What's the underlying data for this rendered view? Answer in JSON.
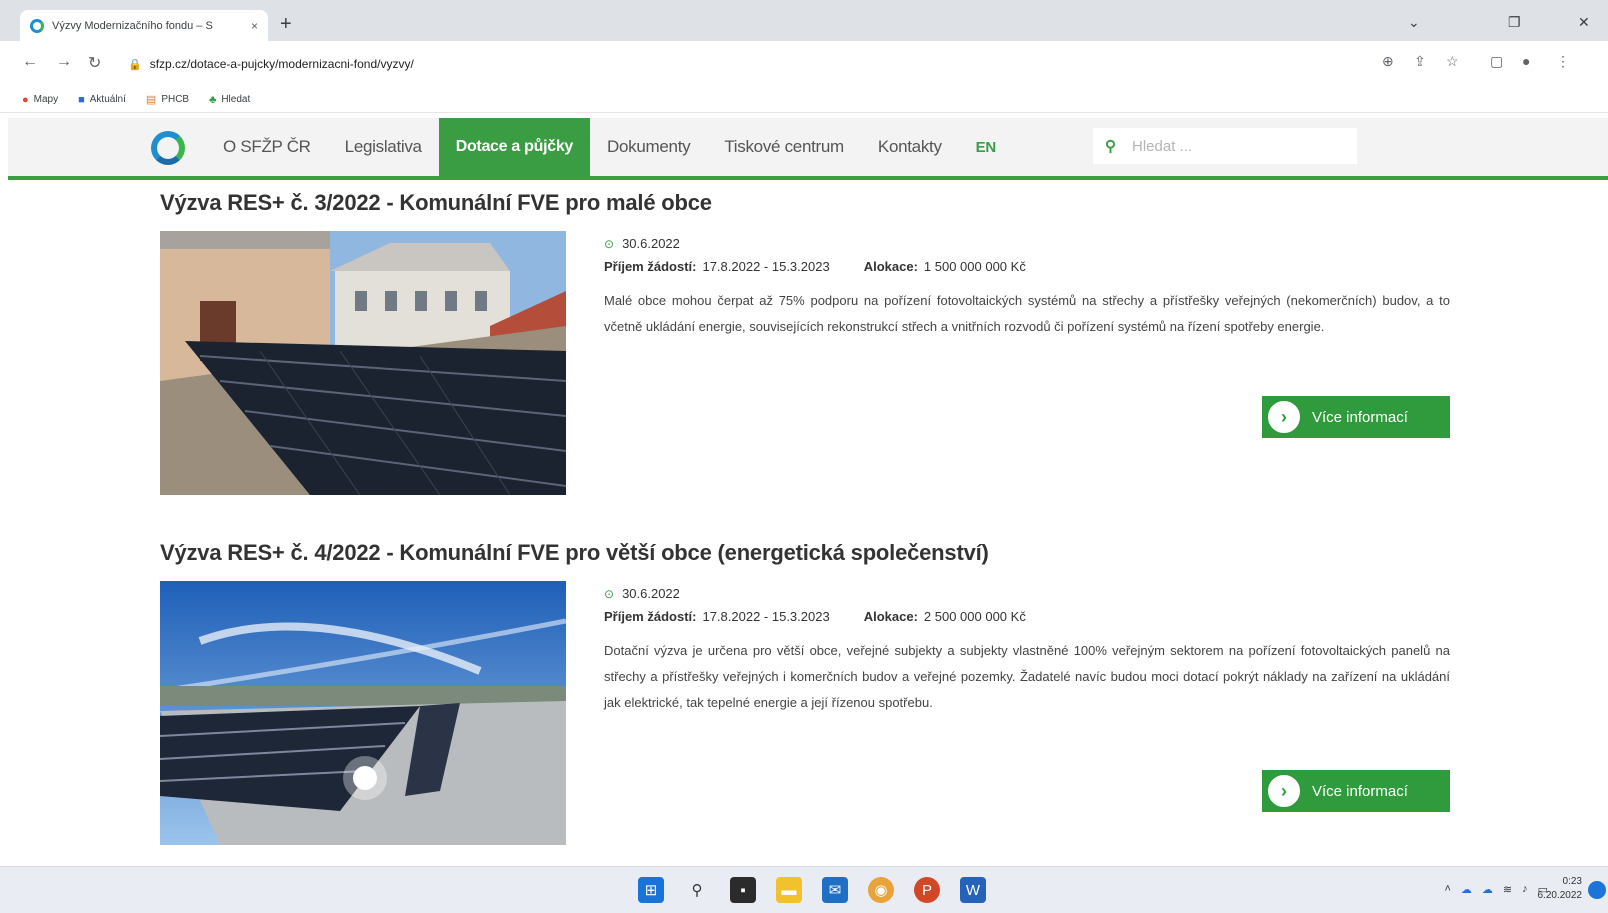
{
  "browser": {
    "tab_title": "Výzvy Modernizačního fondu – S",
    "tab_close": "×",
    "new_tab": "+",
    "url": "sfzp.cz/dotace-a-pujcky/modernizacni-fond/vyzvy/",
    "bookmarks": [
      {
        "label": "Mapy",
        "icon": "map-pin-icon"
      },
      {
        "label": "Aktuální",
        "icon": "news-icon"
      },
      {
        "label": "PHCB",
        "icon": "chart-icon"
      },
      {
        "label": "Hledat",
        "icon": "plant-icon"
      }
    ]
  },
  "site": {
    "menu": [
      "O SFŽP ČR",
      "Legislativa",
      "Dotace a půjčky",
      "Dokumenty",
      "Tiskové centrum",
      "Kontakty"
    ],
    "lang": "EN",
    "search_placeholder": "Hledat ...",
    "brand_color": "#3a9c43"
  },
  "articles": [
    {
      "title": "Výzva RES+ č. 3/2022 - Komunální FVE pro malé obce",
      "date": "30.6.2022",
      "prijem_label": "Příjem žádostí:",
      "prijem_value": "17.8.2022 - 15.3.2023",
      "alokace_label": "Alokace:",
      "alokace_value": "1 500 000 000 Kč",
      "description": "Malé obce mohou čerpat až 75% podporu na pořízení fotovoltaických systémů na střechy a přístřešky veřejných (nekomerčních) budov, a to včetně ukládání energie, souvisejících rekonstrukcí střech a vnitřních rozvodů či pořízení systémů na řízení spotřeby energie.",
      "more": "Více informací"
    },
    {
      "title": "Výzva RES+ č. 4/2022 - Komunální FVE pro větší obce (energetická společenství)",
      "date": "30.6.2022",
      "prijem_label": "Příjem žádostí:",
      "prijem_value": "17.8.2022 - 15.3.2023",
      "alokace_label": "Alokace:",
      "alokace_value": "2 500 000 000 Kč",
      "description": "Dotační výzva je určena pro větší obce, veřejné subjekty a subjekty vlastněné 100% veřejným sektorem na pořízení fotovoltaických panelů na střechy a přístřešky veřejných i komerčních budov a veřejné pozemky. Žadatelé navíc budou moci dotací pokrýt náklady na zařízení na ukládání jak elektrické, tak tepelné energie a její řízenou spotřebu.",
      "more": "Více informací"
    }
  ],
  "taskbar": {
    "time": "0:23",
    "date": "6.20.2022"
  }
}
